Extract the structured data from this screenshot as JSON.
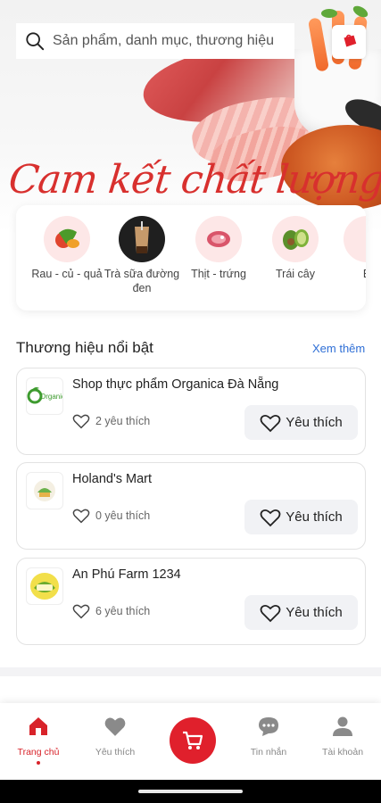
{
  "search": {
    "placeholder": "Sản phẩm, danh mục, thương hiệu",
    "icon": "search-icon"
  },
  "hero": {
    "slogan": "Cam kết chất lượng"
  },
  "categories": [
    {
      "label": "Rau - củ - quả",
      "icon": "vegetables-icon"
    },
    {
      "label": "Trà sữa đường đen",
      "icon": "milk-tea-image"
    },
    {
      "label": "Thịt - trứng",
      "icon": "meat-icon"
    },
    {
      "label": "Trái cây",
      "icon": "fruit-icon"
    },
    {
      "label": "E",
      "icon": "category-icon"
    }
  ],
  "brands_section": {
    "title": "Thương hiệu nổi bật",
    "see_more": "Xem thêm"
  },
  "brands": [
    {
      "name": "Shop thực phẩm Organica Đà Nẵng",
      "likes": "2 yêu thích",
      "button": "Yêu thích",
      "logo_text": "Organica"
    },
    {
      "name": "Holand's Mart",
      "likes": "0 yêu thích",
      "button": "Yêu thích"
    },
    {
      "name": "An Phú Farm 1234",
      "likes": "6 yêu thích",
      "button": "Yêu thích"
    }
  ],
  "nav": {
    "items": [
      {
        "label": "Trang chủ",
        "icon": "home-icon",
        "active": true
      },
      {
        "label": "Yêu thích",
        "icon": "heart-icon"
      },
      {
        "label": "",
        "icon": "cart-icon"
      },
      {
        "label": "Tin nhắn",
        "icon": "chat-icon"
      },
      {
        "label": "Tài khoản",
        "icon": "user-icon"
      }
    ]
  },
  "colors": {
    "brand_red": "#e0202c",
    "link_blue": "#2f6fd6",
    "cat_bg": "#fde7e7"
  }
}
